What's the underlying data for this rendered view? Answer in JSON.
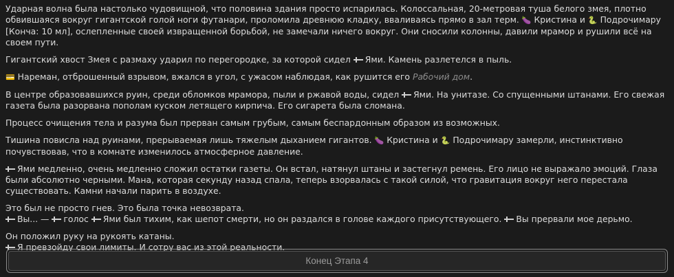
{
  "icons": {
    "eggplant": "🍆",
    "snake": "🐍",
    "card": "💳",
    "sword": "sword-icon"
  },
  "p1": {
    "a": "Ударная волна была настолько чудовищной, что половина здания просто испарилась. Колоссальная, 20-метровая туша белого змея, плотно обвившаяся вокруг гигантской голой ноги футанари, проломила древнюю кладку, вваливаясь прямо в зал терм.",
    "kristina": "Кристина и",
    "b": "Подрочимару [Конча: 10 мл], ослепленные своей извращенной борьбой, не замечали ничего вокруг. Они сносили колонны, давили мрамор и рушили всё на своем пути."
  },
  "p2": {
    "a": "Гигантский хвост Змея с размаху ударил по перегородке, за которой сидел",
    "b": "Ями. Камень разлетелся в пыль."
  },
  "p3": {
    "a": "Нареман, отброшенный взрывом, вжался в угол, с ужасом наблюдая, как рушится его",
    "link": "Рабочий дом",
    "b": "."
  },
  "p4": {
    "a": "В центре образовавшихся руин, среди обломков мрамора, пыли и ржавой воды, сидел",
    "b": "Ями. На унитазе. Со спущенными штанами. Его свежая газета была разорвана пополам куском летящего кирпича. Его сигарета была сломана."
  },
  "p5": "Процесс очищения тела и разума был прерван самым грубым, самым беспардонным образом из возможных.",
  "p6": {
    "a": "Тишина повисла над руинами, прерываемая лишь тяжелым дыханием гигантов.",
    "kristina": "Кристина и",
    "b": "Подрочимару замерли, инстинктивно почувствовав, что в комнате изменилось атмосферное давление."
  },
  "p7": "Ями медленно, очень медленно сложил остатки газеты. Он встал, натянул штаны и застегнул ремень. Его лицо не выражало эмоций. Глаза были абсолютно черными. Мана, которая секунду назад спала, теперь взорвалась с такой силой, что гравитация вокруг него перестала существовать. Камни начали парить в воздухе.",
  "p8": {
    "line1": "Это был не просто гнев. Это была точка невозврата.",
    "a": "Вы... —",
    "b": "голос",
    "c": "Ями был тихим, как шепот смерти, но он раздался в голове каждого присутствующего.",
    "d": "Вы прервали мое дерьмо."
  },
  "p9": {
    "line1": "Он положил руку на рукоять катаны.",
    "line2": "Я превзойду свои лимиты. И сотру вас из этой реальности."
  },
  "end_button": "Конец Этапа 4"
}
